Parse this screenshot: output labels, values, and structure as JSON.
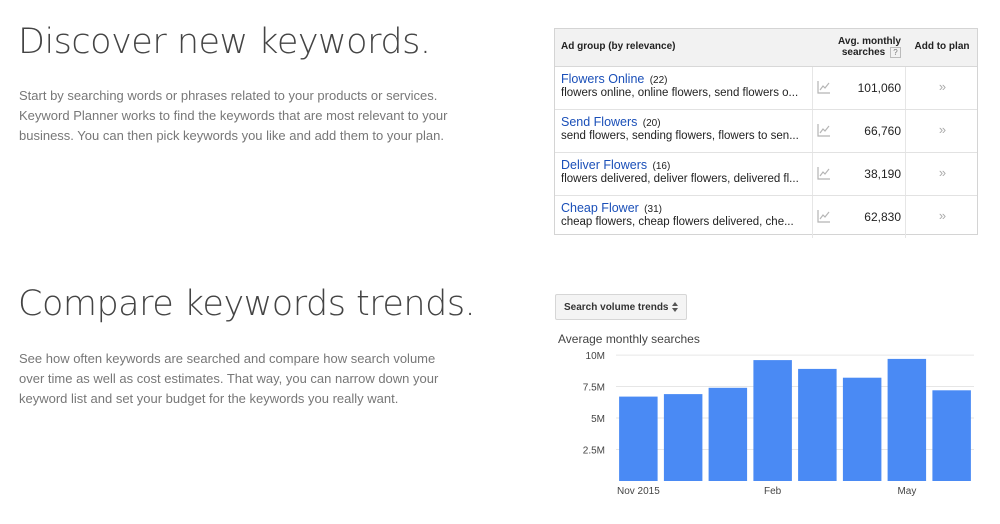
{
  "section1": {
    "title": "Discover new keywords.",
    "description": "Start by searching words or phrases related to your products or services. Keyword Planner works to find the keywords that are most relevant to your business. You can then pick keywords you like and add them to your plan."
  },
  "section2": {
    "title": "Compare keywords trends.",
    "description": "See how often keywords are searched and compare how search volume over time as well as cost estimates. That way, you can narrow down your keyword list and set your budget for the keywords you really want."
  },
  "keyword_table": {
    "headers": {
      "ad_group": "Ad group (by relevance)",
      "avg_line1": "Avg. monthly",
      "avg_line2": "searches",
      "help": "?",
      "add_to_plan": "Add to plan"
    },
    "rows": [
      {
        "name": "Flowers Online",
        "count": "(22)",
        "keywords": "flowers online, online flowers, send flowers o...",
        "value": "101,060",
        "add": "»"
      },
      {
        "name": "Send Flowers",
        "count": "(20)",
        "keywords": "send flowers, sending flowers, flowers to sen...",
        "value": "66,760",
        "add": "»"
      },
      {
        "name": "Deliver Flowers",
        "count": "(16)",
        "keywords": "flowers delivered, deliver flowers, delivered fl...",
        "value": "38,190",
        "add": "»"
      },
      {
        "name": "Cheap Flower",
        "count": "(31)",
        "keywords": "cheap flowers, cheap flowers delivered, che...",
        "value": "62,830",
        "add": "»"
      }
    ],
    "trend_icon": "line-chart-icon",
    "add_icon": "double-chevron-right-icon"
  },
  "trends_select": {
    "label": "Search volume trends",
    "icon": "sort-arrows-icon"
  },
  "chart_data": {
    "type": "bar",
    "title": "Average monthly searches",
    "y_ticks": [
      "2.5M",
      "5M",
      "7.5M",
      "10M"
    ],
    "y_tick_values": [
      2.5,
      5,
      7.5,
      10
    ],
    "x_tick_labels": [
      {
        "label": "Nov 2015",
        "index": 0
      },
      {
        "label": "Feb",
        "index": 3
      },
      {
        "label": "May",
        "index": 6
      }
    ],
    "values": [
      6.7,
      6.9,
      7.4,
      9.6,
      8.9,
      8.2,
      9.7,
      7.2
    ],
    "unit": "M",
    "ylim": [
      0,
      10.8
    ],
    "grid": true,
    "colors": {
      "bar": "#4a8af4",
      "grid": "#e6e6e6"
    }
  }
}
